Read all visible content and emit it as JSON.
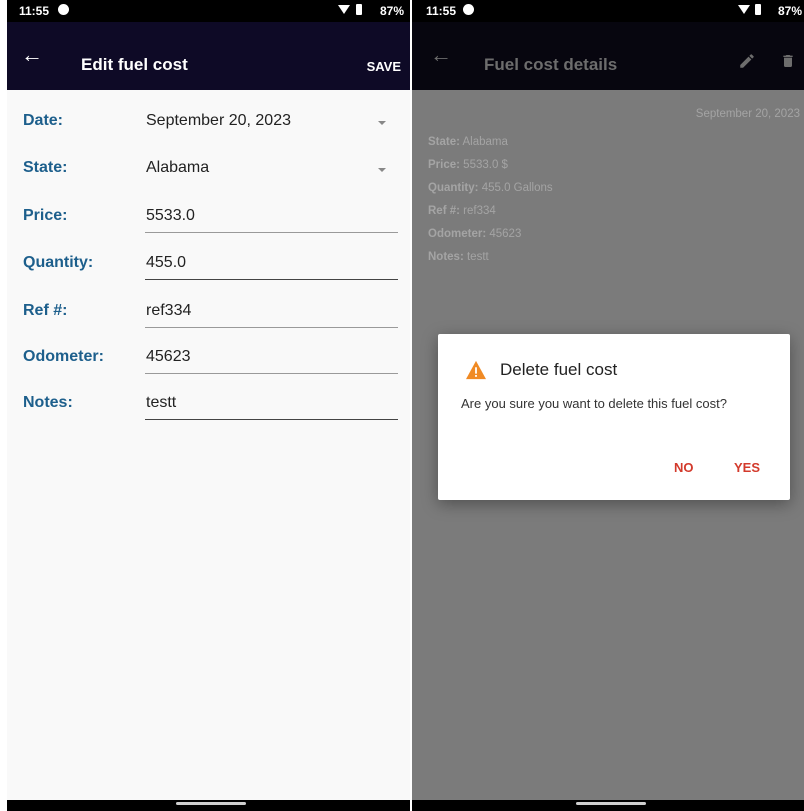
{
  "left": {
    "status": {
      "time": "11:55",
      "battery": "87%"
    },
    "appbar": {
      "back_icon": "arrow-left-icon",
      "title": "Edit fuel cost",
      "save_label": "SAVE"
    },
    "fields": [
      {
        "label": "Date:",
        "value": "September 20, 2023",
        "type": "select"
      },
      {
        "label": "State:",
        "value": "Alabama",
        "type": "select"
      },
      {
        "label": "Price:",
        "value": "5533.0",
        "type": "input"
      },
      {
        "label": "Quantity:",
        "value": "455.0",
        "type": "input"
      },
      {
        "label": "Ref #:",
        "value": "ref334",
        "type": "input"
      },
      {
        "label": "Odometer:",
        "value": "45623",
        "type": "input"
      },
      {
        "label": "Notes:",
        "value": "testt",
        "type": "input"
      }
    ]
  },
  "right": {
    "status": {
      "time": "11:55",
      "battery": "87%"
    },
    "appbar": {
      "back_icon": "arrow-left-icon",
      "title": "Fuel cost details",
      "edit_icon": "pencil-icon",
      "delete_icon": "trash-icon"
    },
    "details": {
      "date": "September 20, 2023",
      "lines": [
        {
          "key": "State:",
          "value": "Alabama"
        },
        {
          "key": "Price:",
          "value": "5533.0 $"
        },
        {
          "key": "Quantity:",
          "value": "455.0 Gallons"
        },
        {
          "key": "Ref #:",
          "value": "ref334"
        },
        {
          "key": "Odometer:",
          "value": "45623"
        },
        {
          "key": "Notes:",
          "value": "testt"
        }
      ]
    },
    "dialog": {
      "icon": "warning-icon",
      "title": "Delete fuel cost",
      "message": "Are you sure you want to delete this fuel cost?",
      "no_label": "NO",
      "yes_label": "YES"
    }
  },
  "colors": {
    "label_blue": "#1d5f8c",
    "appbar": "#0e0a26",
    "dialog_button": "#d33a2c",
    "warning": "#f08a24"
  }
}
